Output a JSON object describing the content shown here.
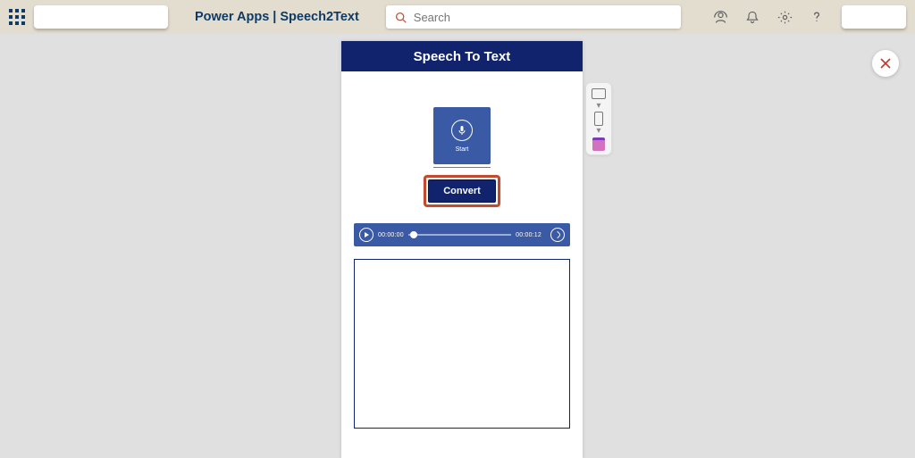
{
  "header": {
    "product": "Power Apps",
    "separator": "|",
    "appname": "Speech2Text",
    "search_placeholder": "Search"
  },
  "app": {
    "title": "Speech To Text",
    "mic_label": "Start",
    "convert_label": "Convert",
    "player": {
      "current": "00:00:00",
      "total": "00:00:12"
    }
  }
}
